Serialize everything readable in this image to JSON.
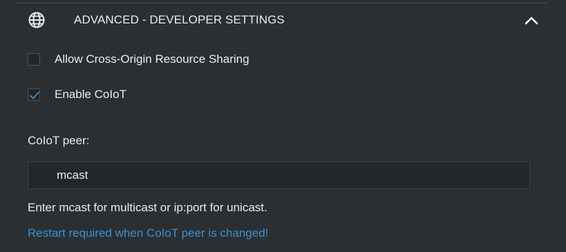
{
  "section": {
    "title": "ADVANCED - DEVELOPER SETTINGS",
    "icon": "globe-icon",
    "collapse_icon": "chevron-up-icon"
  },
  "settings": {
    "cors": {
      "label": "Allow Cross-Origin Resource Sharing",
      "checked": false
    },
    "coiot": {
      "label": "Enable CoIoT",
      "checked": true
    }
  },
  "peer": {
    "label": "CoIoT peer:",
    "value": "mcast",
    "help": "Enter mcast for multicast or ip:port for unicast.",
    "warning": "Restart required when CoIoT peer is changed!"
  },
  "colors": {
    "background": "#2b2f31",
    "text": "#e9ecee",
    "accent": "#3b8fd1",
    "checkmark": "#3b8fd1"
  }
}
